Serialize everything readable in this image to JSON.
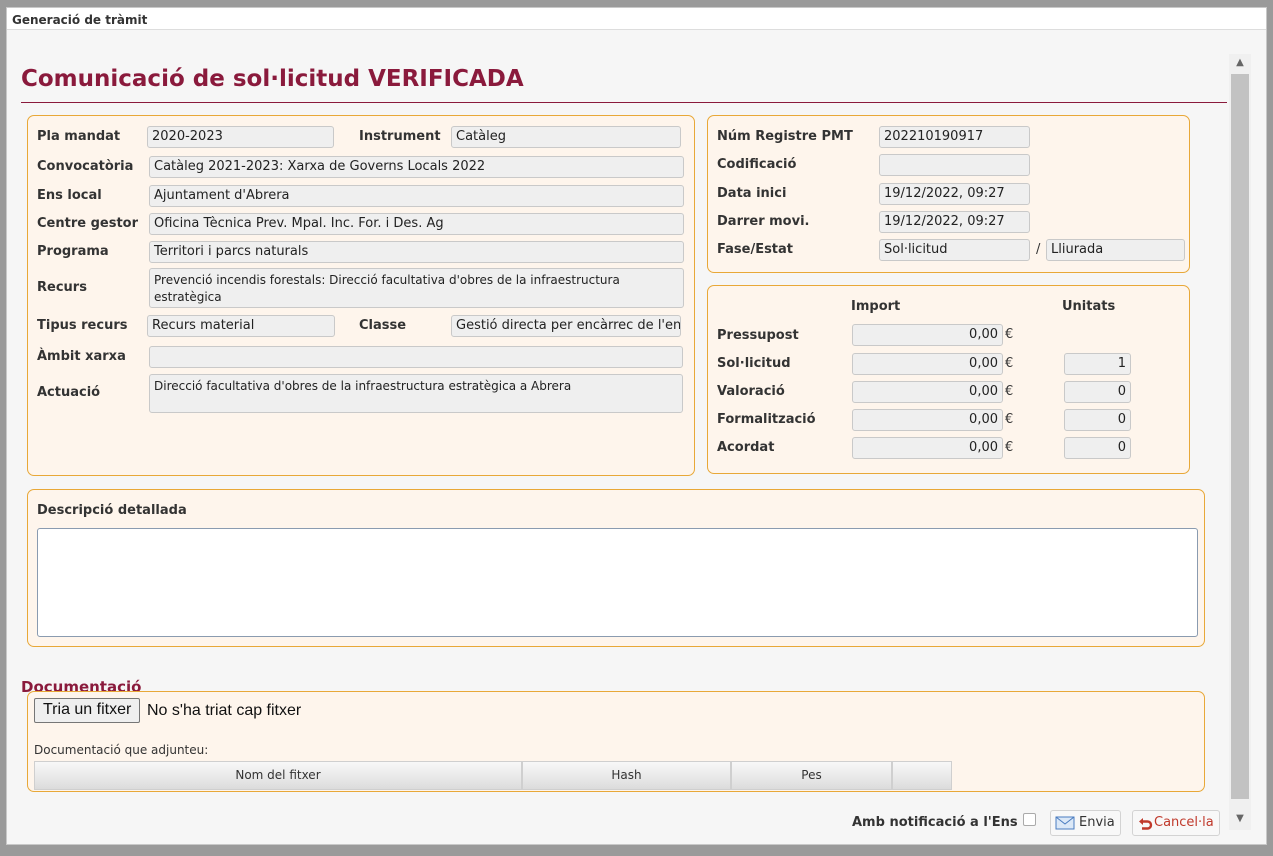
{
  "dialog": {
    "title": "Generació de tràmit"
  },
  "heading": "Comunicació de sol·licitud VERIFICADA",
  "info": {
    "pla_mandat": {
      "label": "Pla mandat",
      "value": "2020-2023"
    },
    "instrument": {
      "label": "Instrument",
      "value": "Catàleg"
    },
    "convocatoria": {
      "label": "Convocatòria",
      "value": "Catàleg 2021-2023: Xarxa de Governs Locals 2022"
    },
    "ens_local": {
      "label": "Ens local",
      "value": "Ajuntament d'Abrera"
    },
    "centre_gestor": {
      "label": "Centre gestor",
      "value": "Oficina Tècnica Prev. Mpal. Inc. For. i Des. Ag"
    },
    "programa": {
      "label": "Programa",
      "value": "Territori i parcs naturals"
    },
    "recurs": {
      "label": "Recurs",
      "value": "Prevenció incendis forestals: Direcció facultativa d'obres de la infraestructura estratègica"
    },
    "tipus_recurs": {
      "label": "Tipus recurs",
      "value": "Recurs material"
    },
    "classe": {
      "label": "Classe",
      "value": "Gestió directa per encàrrec de l'ens"
    },
    "ambit_xarxa": {
      "label": "Àmbit xarxa",
      "value": ""
    },
    "actuacio": {
      "label": "Actuació",
      "value": "Direcció facultativa d'obres de la infraestructura estratègica a Abrera"
    }
  },
  "registre": {
    "num_registre": {
      "label": "Núm Registre PMT",
      "value": "202210190917"
    },
    "codificacio": {
      "label": "Codificació",
      "value": ""
    },
    "data_inici": {
      "label": "Data inici",
      "value": "19/12/2022, 09:27"
    },
    "darrer_movi": {
      "label": "Darrer movi.",
      "value": "19/12/2022, 09:27"
    },
    "fase_estat": {
      "label": "Fase/Estat",
      "fase": "Sol·licitud",
      "separator": "/",
      "estat": "Lliurada"
    }
  },
  "imports": {
    "col_import": "Import",
    "col_unitats": "Unitats",
    "currency": "€",
    "rows": [
      {
        "label": "Pressupost",
        "import": "0,00",
        "unitats": null
      },
      {
        "label": "Sol·licitud",
        "import": "0,00",
        "unitats": "1"
      },
      {
        "label": "Valoració",
        "import": "0,00",
        "unitats": "0"
      },
      {
        "label": "Formalització",
        "import": "0,00",
        "unitats": "0"
      },
      {
        "label": "Acordat",
        "import": "0,00",
        "unitats": "0"
      }
    ]
  },
  "descripcio": {
    "label": "Descripció detallada",
    "value": ""
  },
  "documentacio": {
    "title": "Documentació",
    "file_button": "Tria un fitxer",
    "file_status": "No s'ha triat cap fitxer",
    "attached_label": "Documentació que adjunteu:",
    "columns": [
      "Nom del fitxer",
      "Hash",
      "Pes",
      ""
    ]
  },
  "footer": {
    "notify_label": "Amb notificació a l'Ens",
    "send_label": "Envia",
    "cancel_label": "Cancel·la"
  },
  "colors": {
    "accent": "#8a1a3c",
    "panel_border": "#e8a838",
    "panel_bg": "#fef5ec",
    "cancel_red": "#c0392b"
  }
}
